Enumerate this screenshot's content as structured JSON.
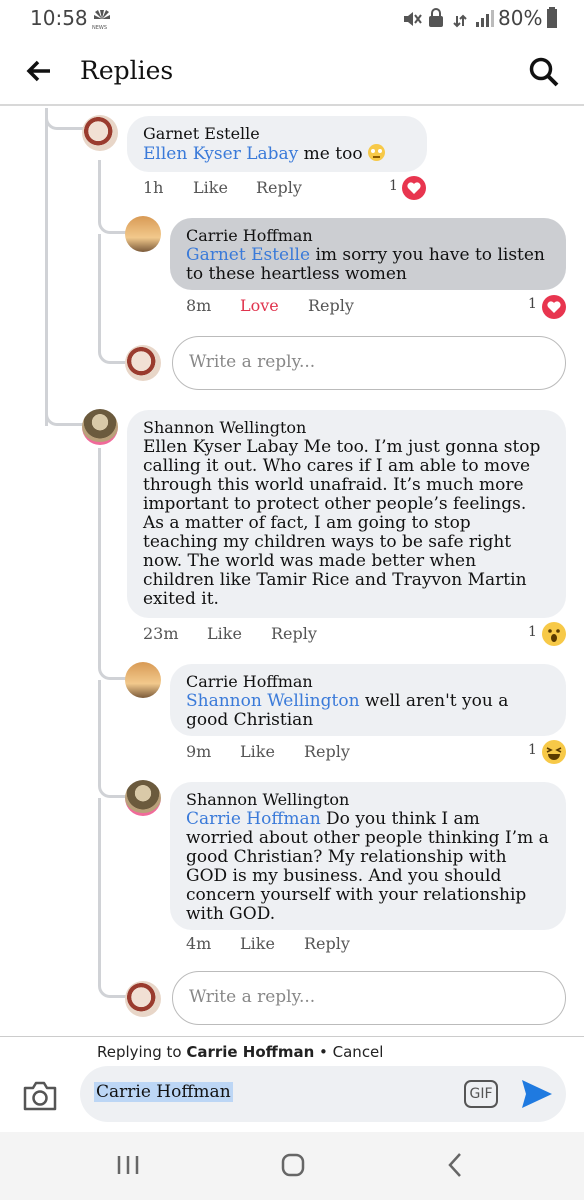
{
  "status_bar": {
    "time": "10:58",
    "news_label": "NEWS",
    "battery": "80%"
  },
  "header": {
    "title": "Replies"
  },
  "comments": [
    {
      "name": "Garnet Estelle",
      "mention": "Ellen Kyser Labay",
      "text": " me too",
      "time": "1h",
      "like": "Like",
      "reply": "Reply",
      "count": "1"
    },
    {
      "name": "Carrie Hoffman",
      "mention": "Garnet Estelle",
      "text": " im sorry you have to listen to these heartless women",
      "time": "8m",
      "like": "Love",
      "reply": "Reply",
      "count": "1"
    },
    {
      "name": "Shannon Wellington",
      "mention": "",
      "text": "Ellen Kyser Labay Me too. I’m just gonna stop calling it out. Who cares if I am able to move through this world unafraid. It’s much more important to protect other people’s feelings. As a matter of fact, I am going to stop teaching my children ways to be safe right now. The world was made better when children like Tamir Rice and Trayvon Martin exited it.",
      "time": "23m",
      "like": "Like",
      "reply": "Reply",
      "count": "1"
    },
    {
      "name": "Carrie Hoffman",
      "mention": "Shannon Wellington",
      "text": " well aren't you a good Christian",
      "time": "9m",
      "like": "Like",
      "reply": "Reply",
      "count": "1"
    },
    {
      "name": "Shannon Wellington",
      "mention": "Carrie Hoffman",
      "text": " Do you think I am worried about other people thinking I’m a good Christian? My relationship with GOD is my business. And you should concern yourself with your relationship with GOD.",
      "time": "4m",
      "like": "Like",
      "reply": "Reply"
    }
  ],
  "write_reply_placeholder": "Write a reply...",
  "replying": {
    "prefix": "Replying to ",
    "name": "Carrie Hoffman",
    "sep": " • ",
    "cancel": "Cancel"
  },
  "composer": {
    "text": "Carrie Hoffman",
    "gif": "GIF"
  },
  "colors": {
    "mention": "#3a7ad9",
    "love": "#e0334d",
    "send": "#1f7ae0"
  }
}
